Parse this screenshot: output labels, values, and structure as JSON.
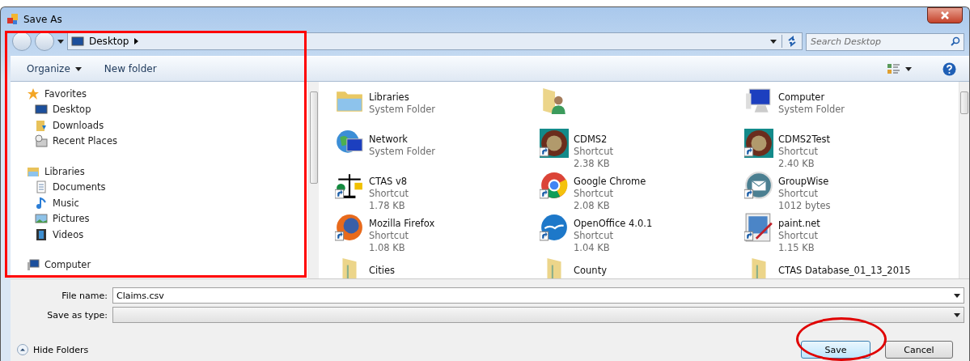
{
  "window": {
    "title": "Save As"
  },
  "address": {
    "location": "Desktop"
  },
  "search": {
    "placeholder": "Search Desktop"
  },
  "toolbar": {
    "organize": "Organize",
    "new_folder": "New folder"
  },
  "sidebar": {
    "items": [
      {
        "label": "Favorites",
        "children": [
          {
            "label": "Desktop"
          },
          {
            "label": "Downloads"
          },
          {
            "label": "Recent Places"
          }
        ]
      },
      {
        "label": "Libraries",
        "children": [
          {
            "label": "Documents"
          },
          {
            "label": "Music"
          },
          {
            "label": "Pictures"
          },
          {
            "label": "Videos"
          }
        ]
      },
      {
        "label": "Computer"
      }
    ]
  },
  "files": [
    {
      "name": "Libraries",
      "details": [
        "System Folder"
      ],
      "kind": "libraries"
    },
    {
      "kind": "user"
    },
    {
      "name": "Computer",
      "details": [
        "System Folder"
      ],
      "kind": "computer"
    },
    {
      "name": "Network",
      "details": [
        "System Folder"
      ],
      "kind": "network"
    },
    {
      "name": "CDMS2",
      "details": [
        "Shortcut",
        "2.38 KB"
      ],
      "kind": "seal"
    },
    {
      "name": "CDMS2Test",
      "details": [
        "Shortcut",
        "2.40 KB"
      ],
      "kind": "seal"
    },
    {
      "name": "CTAS v8",
      "details": [
        "Shortcut",
        "1.78 KB"
      ],
      "kind": "scales"
    },
    {
      "name": "Google Chrome",
      "details": [
        "Shortcut",
        "2.08 KB"
      ],
      "kind": "chrome"
    },
    {
      "name": "GroupWise",
      "details": [
        "Shortcut",
        "1012 bytes"
      ],
      "kind": "envelope"
    },
    {
      "name": "Mozilla Firefox",
      "details": [
        "Shortcut",
        "1.08 KB"
      ],
      "kind": "firefox"
    },
    {
      "name": "OpenOffice 4.0.1",
      "details": [
        "Shortcut",
        "1.04 KB"
      ],
      "kind": "birds"
    },
    {
      "name": "paint.net",
      "details": [
        "Shortcut",
        "1.15 KB"
      ],
      "kind": "paint"
    },
    {
      "name": "Cities",
      "kind": "folder"
    },
    {
      "name": "County",
      "kind": "folder"
    },
    {
      "name": "CTAS Database_01_13_2015",
      "kind": "folder"
    }
  ],
  "form": {
    "file_name_label": "File name:",
    "file_name": "Claims.csv",
    "type_label": "Save as type:"
  },
  "hide_folders": "Hide Folders",
  "buttons": [
    {
      "label": "Save",
      "kind": "default"
    },
    {
      "label": "Cancel",
      "kind": "normal"
    }
  ],
  "annotations": {
    "navigation_box": true,
    "save_circle": true
  }
}
